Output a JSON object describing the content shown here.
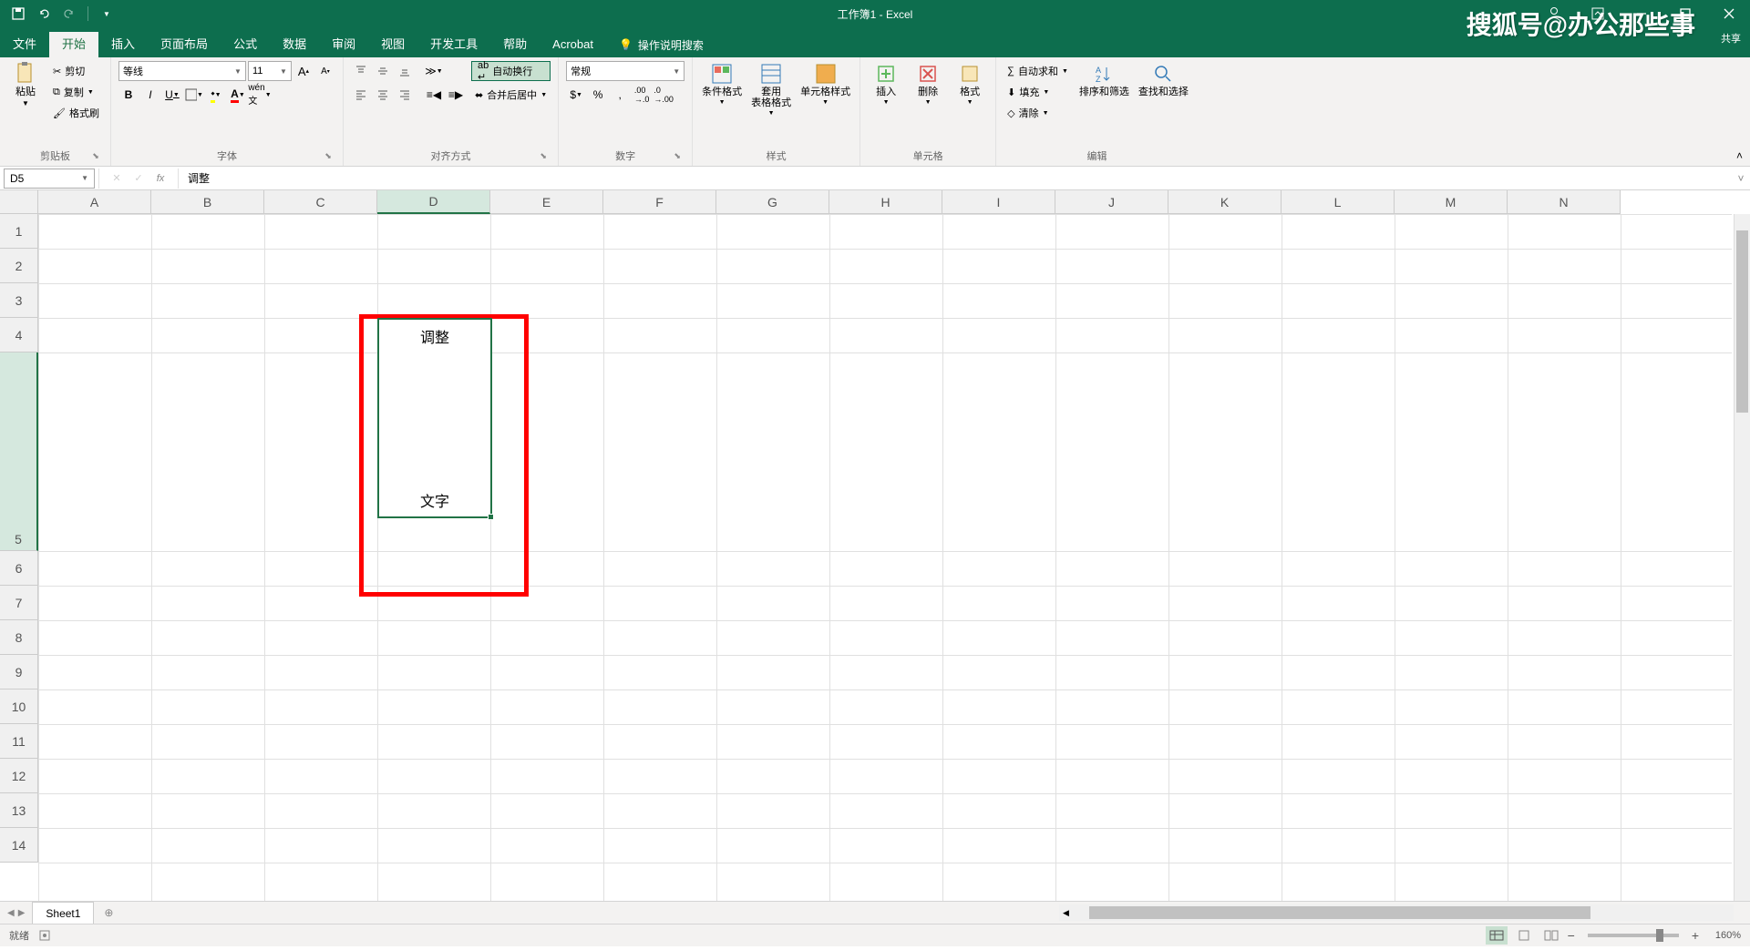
{
  "app": {
    "title": "工作簿1 - Excel"
  },
  "watermark": "搜狐号@办公那些事",
  "share_label": "共享",
  "tabs": {
    "file": "文件",
    "home": "开始",
    "insert": "插入",
    "layout": "页面布局",
    "formulas": "公式",
    "data": "数据",
    "review": "审阅",
    "view": "视图",
    "dev": "开发工具",
    "help": "帮助",
    "acrobat": "Acrobat",
    "tellme": "操作说明搜索"
  },
  "ribbon": {
    "clipboard": {
      "label": "剪贴板",
      "paste": "粘贴",
      "cut": "剪切",
      "copy": "复制",
      "format_painter": "格式刷"
    },
    "font": {
      "label": "字体",
      "name": "等线",
      "size": "11",
      "increase": "A",
      "decrease": "A"
    },
    "align": {
      "label": "对齐方式",
      "wrap": "自动换行",
      "merge": "合并后居中"
    },
    "number": {
      "label": "数字",
      "format": "常规"
    },
    "styles": {
      "label": "样式",
      "cond": "条件格式",
      "table": "套用\n表格格式",
      "cell": "单元格样式"
    },
    "cells": {
      "label": "单元格",
      "insert": "插入",
      "delete": "删除",
      "format": "格式"
    },
    "editing": {
      "label": "编辑",
      "autosum": "自动求和",
      "fill": "填充",
      "clear": "清除",
      "sort": "排序和筛选",
      "find": "查找和选择"
    }
  },
  "namebox": "D5",
  "formula": "调整",
  "columns": [
    "A",
    "B",
    "C",
    "D",
    "E",
    "F",
    "G",
    "H",
    "I",
    "J",
    "K",
    "L",
    "M",
    "N"
  ],
  "rows": [
    "1",
    "2",
    "3",
    "4",
    "5",
    "6",
    "7",
    "8",
    "9",
    "10",
    "11",
    "12",
    "13",
    "14"
  ],
  "cell_content": {
    "line1": "调整",
    "line2": "文字"
  },
  "sheet_tab": "Sheet1",
  "status": {
    "ready": "就绪",
    "zoom": "160%"
  }
}
